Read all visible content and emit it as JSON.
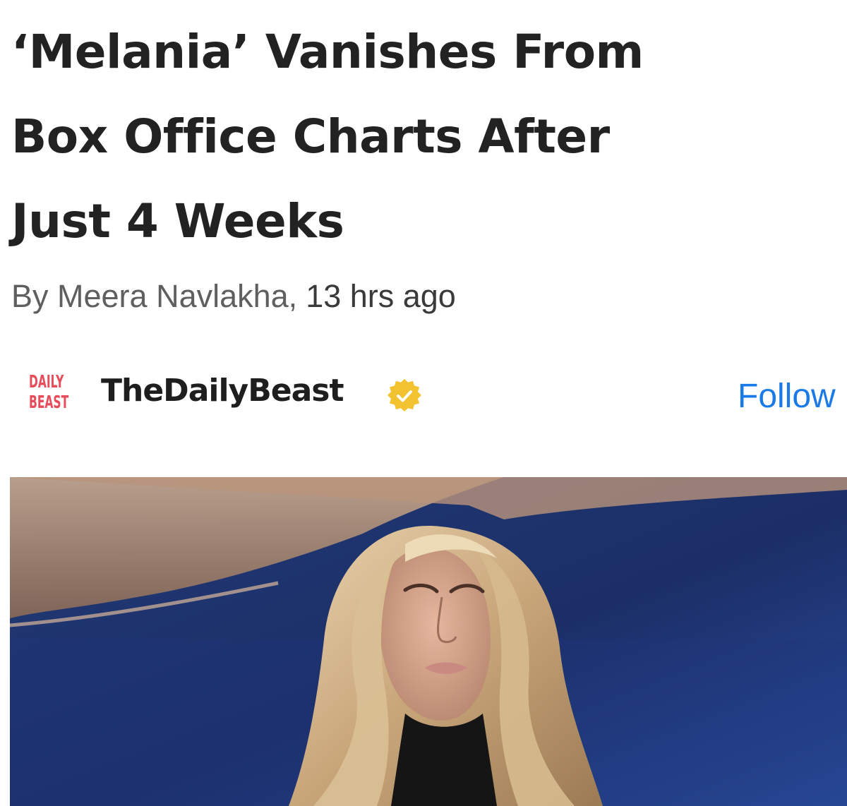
{
  "article": {
    "headline_lines": [
      "‘Melania’ Vanishes From",
      "Box Office Charts After",
      "Just 4 Weeks"
    ],
    "byline_author": "By Meera Navlakha,",
    "byline_time": "13 hrs ago"
  },
  "source": {
    "logo_line1": "DAILY",
    "logo_line2": "BEAST",
    "name": "TheDailyBeast",
    "verified_icon": "verified-badge-icon",
    "follow_label": "Follow"
  },
  "colors": {
    "headline": "#222222",
    "byline": "#5f5f5f",
    "logo_red": "#e84b5a",
    "follow_blue": "#1a7ae8",
    "badge_gold": "#f2c230",
    "photo_bg": "#1c2f66"
  }
}
